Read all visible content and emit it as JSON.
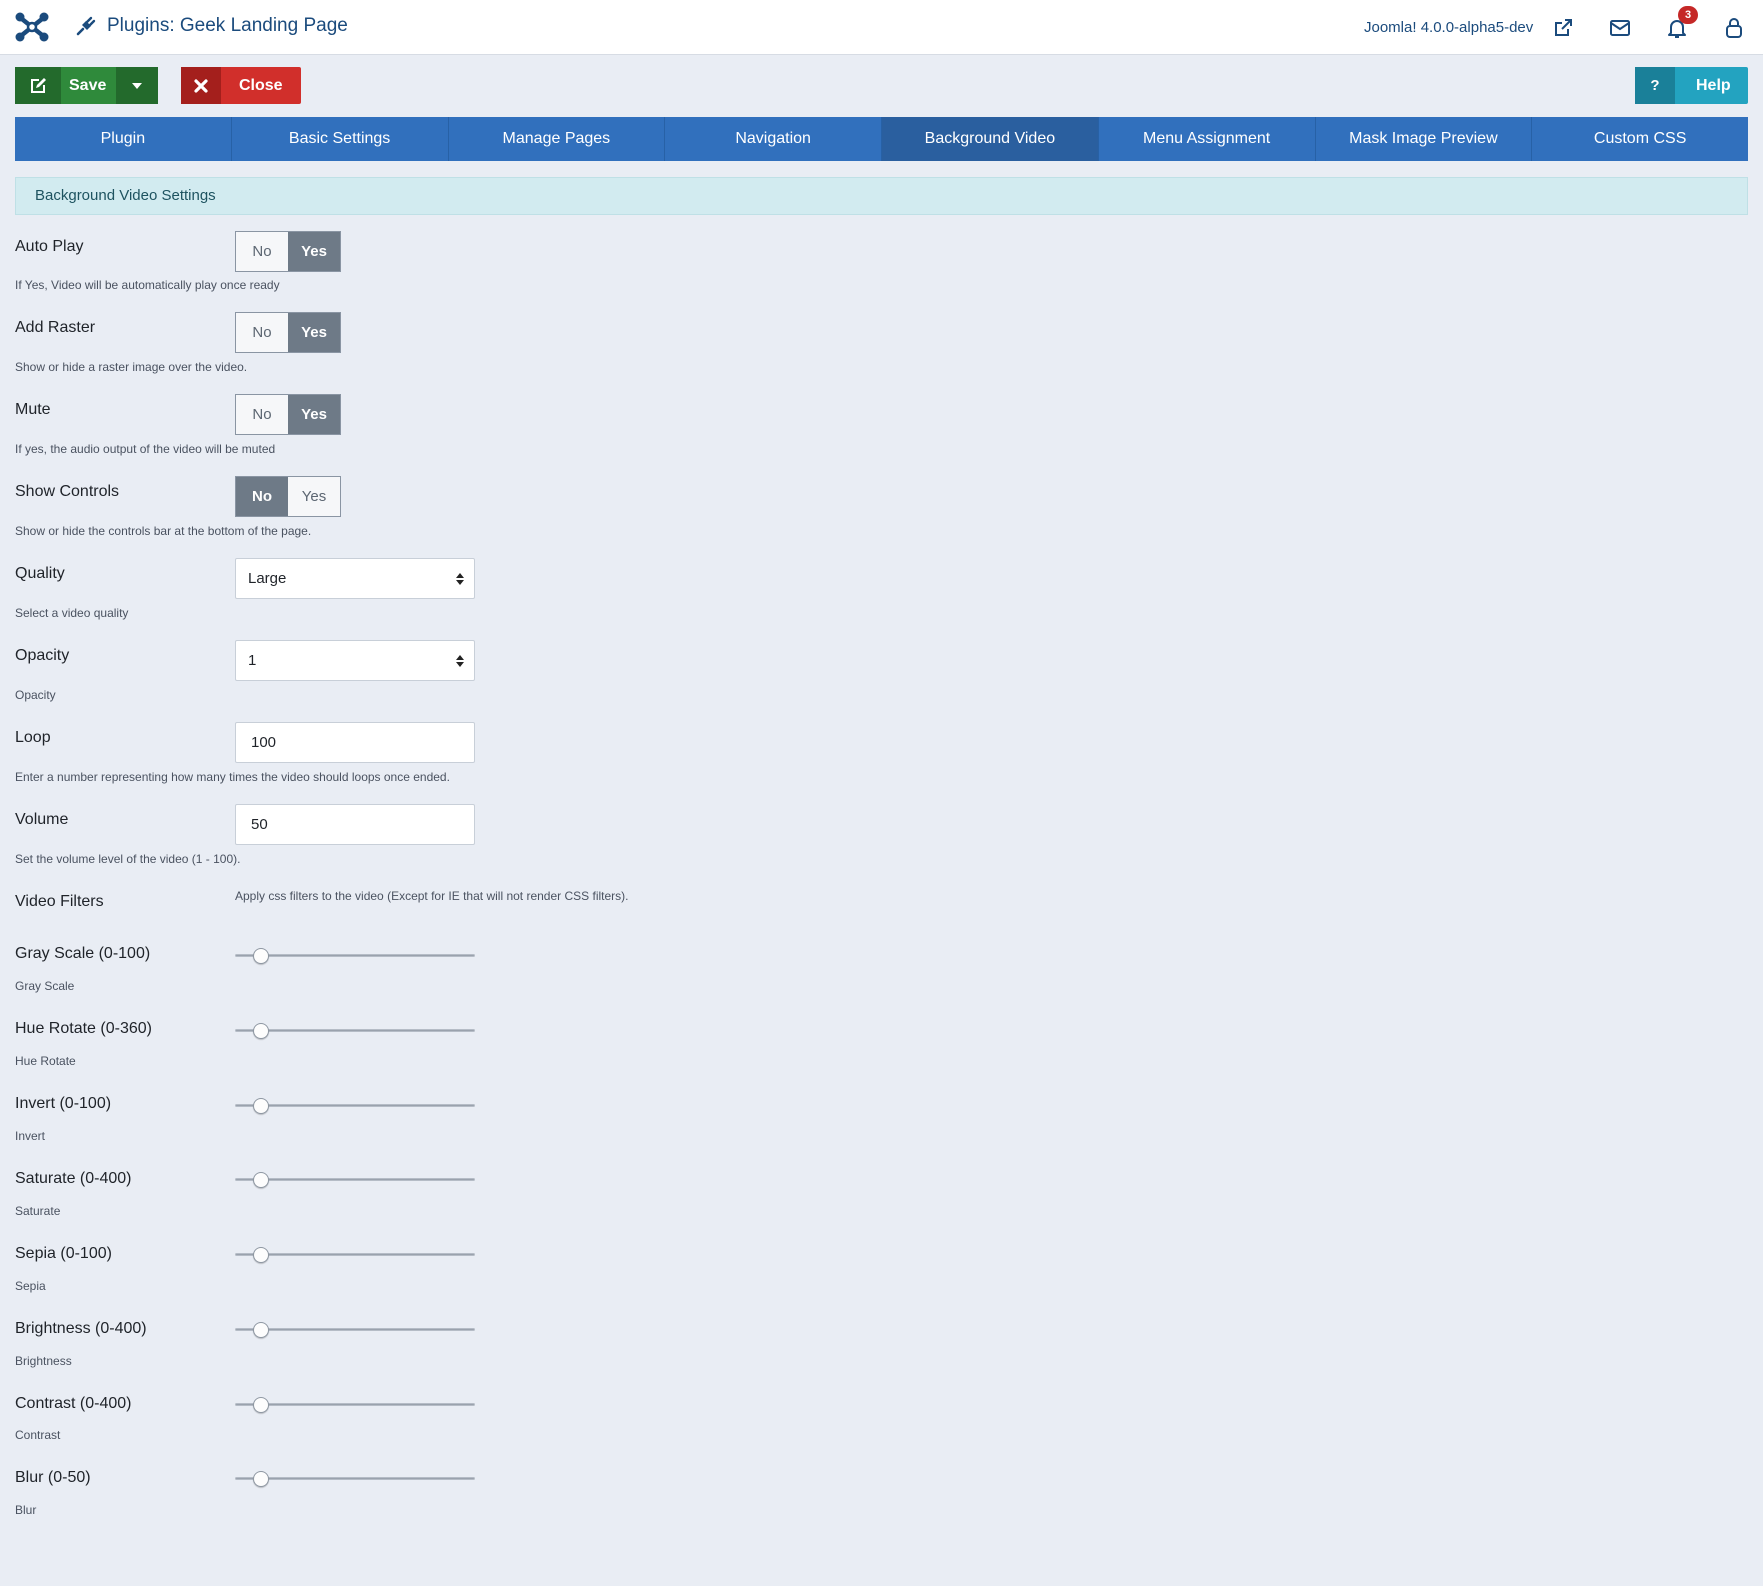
{
  "header": {
    "title": "Plugins: Geek Landing Page",
    "version": "Joomla! 4.0.0-alpha5-dev",
    "notification_count": "3"
  },
  "toolbar": {
    "save_label": "Save",
    "close_label": "Close",
    "help_label": "Help",
    "help_icon": "?"
  },
  "tabs": [
    {
      "label": "Plugin"
    },
    {
      "label": "Basic Settings"
    },
    {
      "label": "Manage Pages"
    },
    {
      "label": "Navigation"
    },
    {
      "label": "Background Video",
      "active": true
    },
    {
      "label": "Menu Assignment"
    },
    {
      "label": "Mask Image Preview"
    },
    {
      "label": "Custom CSS"
    }
  ],
  "section": {
    "title": "Background Video Settings"
  },
  "toggles": [
    {
      "label": "Auto Play",
      "desc": "If Yes, Video will be automatically play once ready",
      "no": "No",
      "yes": "Yes",
      "value": "Yes"
    },
    {
      "label": "Add Raster",
      "desc": "Show or hide a raster image over the video.",
      "no": "No",
      "yes": "Yes",
      "value": "Yes"
    },
    {
      "label": "Mute",
      "desc": "If yes, the audio output of the video will be muted",
      "no": "No",
      "yes": "Yes",
      "value": "Yes"
    },
    {
      "label": "Show Controls",
      "desc": "Show or hide the controls bar at the bottom of the page.",
      "no": "No",
      "yes": "Yes",
      "value": "No"
    }
  ],
  "quality": {
    "label": "Quality",
    "value": "Large",
    "desc": "Select a video quality"
  },
  "opacity": {
    "label": "Opacity",
    "value": "1",
    "desc": "Opacity"
  },
  "loop": {
    "label": "Loop",
    "value": "100",
    "desc": "Enter a number representing how many times the video should loops once ended."
  },
  "volume": {
    "label": "Volume",
    "value": "50",
    "desc": "Set the volume level of the video (1 - 100)."
  },
  "video_filters": {
    "label": "Video Filters",
    "note": "Apply css filters to the video (Except for IE that will not render CSS filters)."
  },
  "sliders": [
    {
      "label": "Gray Scale (0-100)",
      "desc": "Gray Scale",
      "fraction": 0.04
    },
    {
      "label": "Hue Rotate (0-360)",
      "desc": "Hue Rotate",
      "fraction": 0.04
    },
    {
      "label": "Invert (0-100)",
      "desc": "Invert",
      "fraction": 0.04
    },
    {
      "label": "Saturate (0-400)",
      "desc": "Saturate",
      "fraction": 0.04
    },
    {
      "label": "Sepia (0-100)",
      "desc": "Sepia",
      "fraction": 0.04
    },
    {
      "label": "Brightness (0-400)",
      "desc": "Brightness",
      "fraction": 0.04
    },
    {
      "label": "Contrast (0-400)",
      "desc": "Contrast",
      "fraction": 0.04
    },
    {
      "label": "Blur (0-50)",
      "desc": "Blur",
      "fraction": 0.04
    }
  ],
  "colors": {
    "brand_blue": "#1b4b7d",
    "tab_blue": "#3170bd",
    "save_green": "#2f8a3b",
    "close_red": "#d12f2b",
    "help_teal": "#23a3c0"
  }
}
